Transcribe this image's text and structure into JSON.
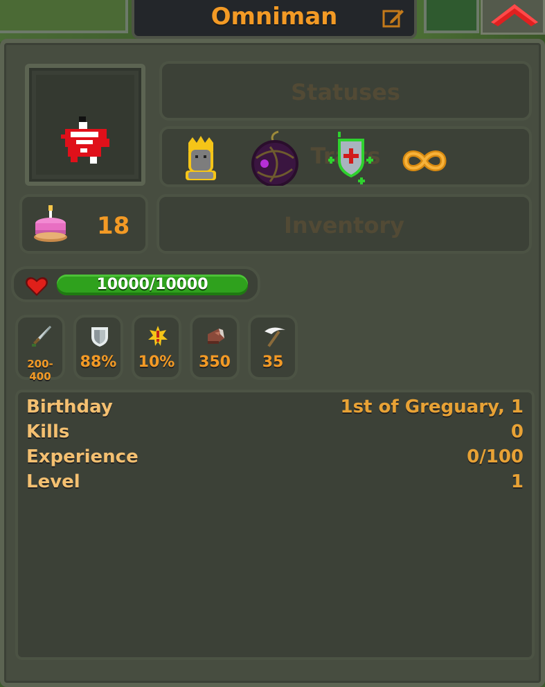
{
  "character": {
    "name": "Omniman",
    "age": "18",
    "health": "10000/10000",
    "health_fraction": 1.0
  },
  "buttons": {
    "statuses": "Statuses",
    "traits": "Traits",
    "inventory": "Inventory"
  },
  "traits": [
    {
      "icon": "golden-idol-icon"
    },
    {
      "icon": "dark-orb-icon"
    },
    {
      "icon": "healing-shield-icon"
    },
    {
      "icon": "infinity-icon"
    }
  ],
  "stats": [
    {
      "icon": "sword-icon",
      "value": "200-400"
    },
    {
      "icon": "shield-icon",
      "value": "88%"
    },
    {
      "icon": "crit-star-icon",
      "value": "10%"
    },
    {
      "icon": "boot-icon",
      "value": "350"
    },
    {
      "icon": "scythe-icon",
      "value": "35"
    }
  ],
  "info": [
    {
      "label": "Birthday",
      "value": "1st of Greguary, 1"
    },
    {
      "label": "Kills",
      "value": "0"
    },
    {
      "label": "Experience",
      "value": "0/100"
    },
    {
      "label": "Level",
      "value": "1"
    }
  ],
  "colors": {
    "accent": "#f39a25",
    "panel": "#474d40",
    "health": "#2fa11d"
  }
}
